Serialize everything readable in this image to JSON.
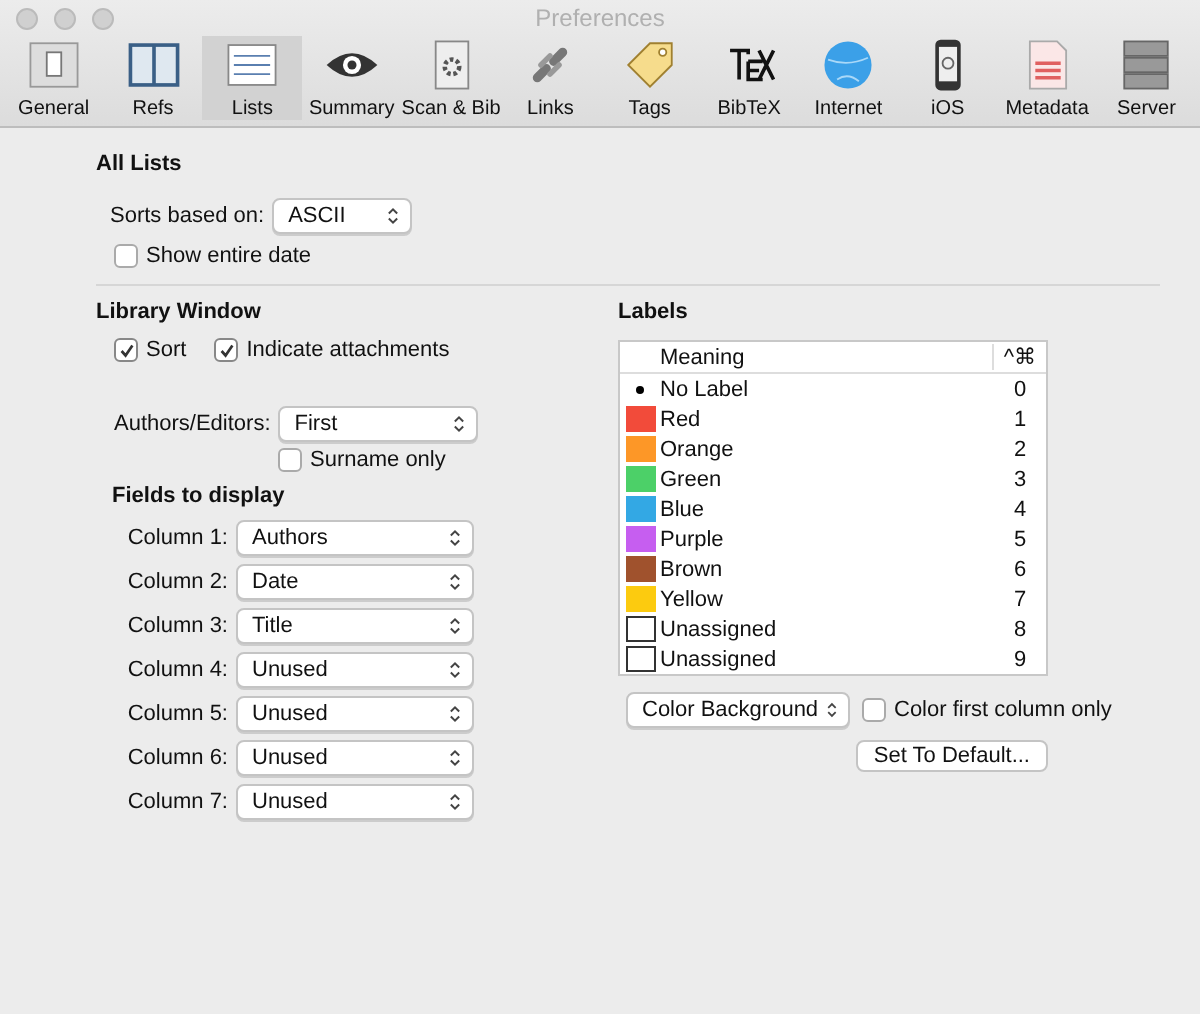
{
  "window": {
    "title": "Preferences"
  },
  "toolbar": [
    {
      "label": "General",
      "selected": false
    },
    {
      "label": "Refs",
      "selected": false
    },
    {
      "label": "Lists",
      "selected": true
    },
    {
      "label": "Summary",
      "selected": false
    },
    {
      "label": "Scan & Bib",
      "selected": false
    },
    {
      "label": "Links",
      "selected": false
    },
    {
      "label": "Tags",
      "selected": false
    },
    {
      "label": "BibTeX",
      "selected": false
    },
    {
      "label": "Internet",
      "selected": false
    },
    {
      "label": "iOS",
      "selected": false
    },
    {
      "label": "Metadata",
      "selected": false
    },
    {
      "label": "Server",
      "selected": false
    }
  ],
  "all_lists": {
    "title": "All Lists",
    "sort_label": "Sorts based on:",
    "sort_value": "ASCII",
    "show_entire_date": {
      "label": "Show entire date",
      "checked": false
    }
  },
  "library_window": {
    "title": "Library Window",
    "sort": {
      "label": "Sort",
      "checked": true
    },
    "indicate_attachments": {
      "label": "Indicate attachments",
      "checked": true
    },
    "authors_label": "Authors/Editors:",
    "authors_value": "First",
    "surname_only": {
      "label": "Surname only",
      "checked": false
    },
    "fields_title": "Fields to display",
    "columns": [
      {
        "label": "Column 1:",
        "value": "Authors"
      },
      {
        "label": "Column 2:",
        "value": "Date"
      },
      {
        "label": "Column 3:",
        "value": "Title"
      },
      {
        "label": "Column 4:",
        "value": "Unused"
      },
      {
        "label": "Column 5:",
        "value": "Unused"
      },
      {
        "label": "Column 6:",
        "value": "Unused"
      },
      {
        "label": "Column 7:",
        "value": "Unused"
      }
    ]
  },
  "labels": {
    "title": "Labels",
    "columns": [
      "Meaning",
      "^⌘"
    ],
    "rows": [
      {
        "kind": "dot",
        "name": "No Label",
        "key": "0"
      },
      {
        "kind": "swatch",
        "color": "#f24b3a",
        "name": "Red",
        "key": "1"
      },
      {
        "kind": "swatch",
        "color": "#fd9727",
        "name": "Orange",
        "key": "2"
      },
      {
        "kind": "swatch",
        "color": "#4cd068",
        "name": "Green",
        "key": "3"
      },
      {
        "kind": "swatch",
        "color": "#33a8e4",
        "name": "Blue",
        "key": "4"
      },
      {
        "kind": "swatch",
        "color": "#c65ef0",
        "name": "Purple",
        "key": "5"
      },
      {
        "kind": "swatch",
        "color": "#a0522d",
        "name": "Brown",
        "key": "6"
      },
      {
        "kind": "swatch",
        "color": "#fccb0f",
        "name": "Yellow",
        "key": "7"
      },
      {
        "kind": "empty",
        "name": "Unassigned",
        "key": "8"
      },
      {
        "kind": "empty",
        "name": "Unassigned",
        "key": "9"
      }
    ],
    "color_mode": "Color Background",
    "first_column_only": {
      "label": "Color first column only",
      "checked": false
    },
    "default_button": "Set To Default..."
  }
}
